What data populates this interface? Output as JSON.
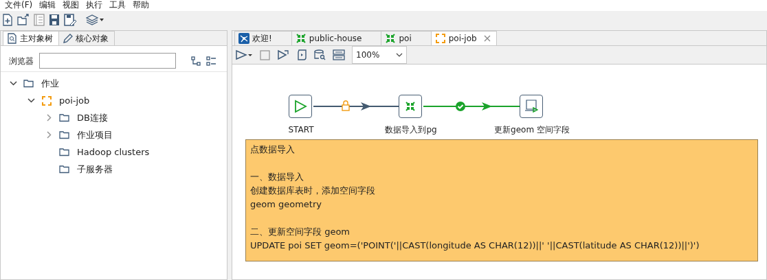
{
  "menu": [
    "文件(F)",
    "编辑",
    "视图",
    "执行",
    "工具",
    "帮助"
  ],
  "left_tabs": [
    {
      "label": "主对象树",
      "kind": "tree",
      "selected": true
    },
    {
      "label": "核心对象",
      "kind": "pencil",
      "selected": false
    }
  ],
  "browser": {
    "label": "浏览器"
  },
  "tree": [
    {
      "label": "作业",
      "kind": "folder",
      "expanded": true,
      "children": [
        {
          "label": "poi-job",
          "kind": "job",
          "expanded": true,
          "children": [
            {
              "label": "DB连接",
              "kind": "folder",
              "expanded": false
            },
            {
              "label": "作业项目",
              "kind": "folder",
              "expanded": false
            },
            {
              "label": "Hadoop clusters",
              "kind": "folder"
            },
            {
              "label": "子服务器",
              "kind": "folder"
            }
          ]
        }
      ]
    }
  ],
  "editor_tabs": [
    {
      "label": "欢迎!",
      "kind": "welcome",
      "selected": false,
      "closable": false
    },
    {
      "label": "public-house",
      "kind": "transform",
      "selected": false,
      "closable": false
    },
    {
      "label": "poi",
      "kind": "transform",
      "selected": false,
      "closable": false
    },
    {
      "label": "poi-job",
      "kind": "job",
      "selected": true,
      "closable": true
    }
  ],
  "zoom": {
    "value": "100%"
  },
  "nodes": [
    {
      "label": "START",
      "kind": "start"
    },
    {
      "label": "数据导入到pg",
      "kind": "transform"
    },
    {
      "label": "更新geom 空间字段",
      "kind": "sql"
    }
  ],
  "hops": [
    {
      "kind": "locked",
      "color": "#435a70"
    },
    {
      "kind": "success",
      "color": "#1aa32a"
    }
  ],
  "note": {
    "paragraphs": [
      [
        "点数据导入"
      ],
      [
        "一、数据导入",
        "创建数据库表时，添加空间字段",
        "geom geometry"
      ],
      [
        "二、更新空间字段 geom",
        "UPDATE poi SET geom=('POINT('||CAST(longitude AS CHAR(12))||' '||CAST(latitude AS CHAR(12))||')')"
      ]
    ]
  }
}
